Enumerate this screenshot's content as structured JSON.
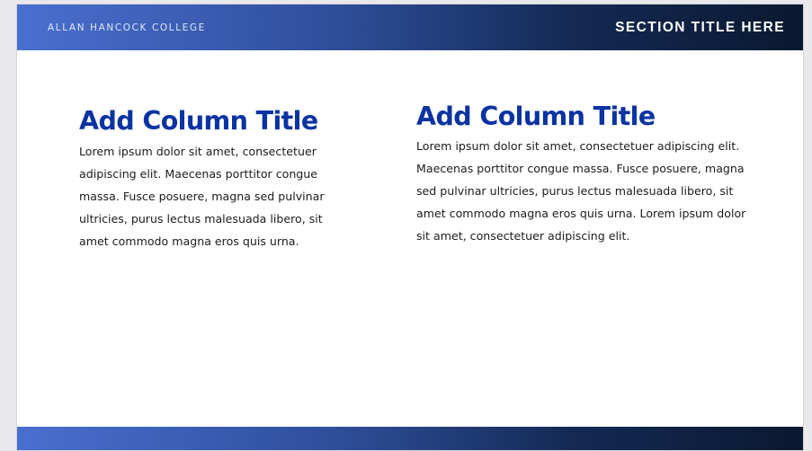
{
  "header": {
    "college_name": "ALLAN HANCOCK COLLEGE",
    "section_title": "SECTION TITLE HERE"
  },
  "columns": [
    {
      "title": "Add Column Title",
      "body": "Lorem ipsum dolor sit amet, consectetuer adipiscing elit. Maecenas porttitor congue massa. Fusce posuere, magna sed pulvinar ultricies, purus lectus malesuada libero, sit amet commodo magna eros quis urna."
    },
    {
      "title": "Add Column Title",
      "body": "Lorem ipsum dolor sit amet, consectetuer adipiscing elit. Maecenas porttitor congue massa. Fusce posuere, magna sed pulvinar ultricies, purus lectus malesuada libero, sit amet commodo magna eros quis urna. Lorem ipsum dolor sit amet, consectetuer adipiscing elit."
    }
  ],
  "colors": {
    "title_blue": "#0a33a3",
    "bar_start": "#4a6fcf",
    "bar_end": "#0a1930"
  }
}
